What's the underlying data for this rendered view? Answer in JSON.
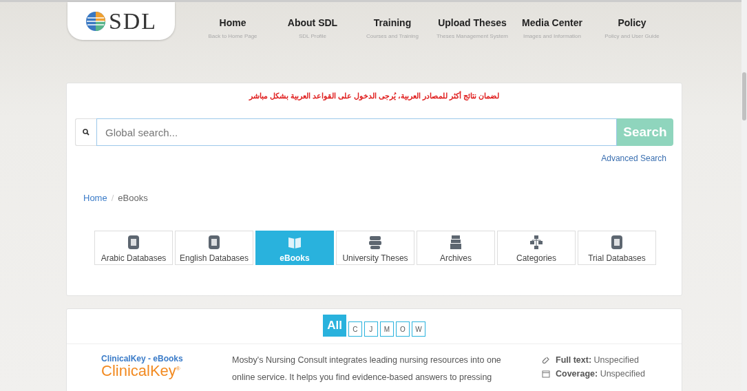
{
  "logo": {
    "text": "SDL"
  },
  "nav": [
    {
      "label": "Home",
      "subtitle": "Back to Home Page"
    },
    {
      "label": "About SDL",
      "subtitle": "SDL Profile"
    },
    {
      "label": "Training",
      "subtitle": "Courses and Training"
    },
    {
      "label": "Upload Theses",
      "subtitle": "Theses Management System"
    },
    {
      "label": "Media Center",
      "subtitle": "Images and Information"
    },
    {
      "label": "Policy",
      "subtitle": "Policy and User Guide"
    }
  ],
  "notice": "لضمان نتائج أكثر للمصادر العربية، يُرجى الدخول على القواعد العربية بشكل مباشر",
  "search": {
    "placeholder": "Global search...",
    "button": "Search",
    "advanced": "Advanced Search"
  },
  "breadcrumb": [
    "Home",
    "eBooks"
  ],
  "breadcrumb_separator": "/",
  "categories": [
    {
      "label": "Arabic Databases",
      "kind": "arabic",
      "selected": false
    },
    {
      "label": "English Databases",
      "kind": "english",
      "selected": false
    },
    {
      "label": "eBooks",
      "kind": "book",
      "selected": true
    },
    {
      "label": "University Theses",
      "kind": "theses",
      "selected": false
    },
    {
      "label": "Archives",
      "kind": "archives",
      "selected": false
    },
    {
      "label": "Categories",
      "kind": "categories",
      "selected": false
    },
    {
      "label": "Trial Databases",
      "kind": "trial",
      "selected": false
    }
  ],
  "letters": [
    {
      "label": "All",
      "selected": true
    },
    {
      "label": "C",
      "selected": false
    },
    {
      "label": "J",
      "selected": false
    },
    {
      "label": "M",
      "selected": false
    },
    {
      "label": "O",
      "selected": false
    },
    {
      "label": "W",
      "selected": false
    }
  ],
  "resource": {
    "title": "ClinicalKey - eBooks",
    "logo_text": "ClinicalKey$^{®}$",
    "description": "Mosby's Nursing Consult integrates leading nursing resources into one online service. It helps you find evidence-based answers to pressing",
    "meta": [
      {
        "kind": "link",
        "label": "Full text:",
        "value": "Unspecified"
      },
      {
        "kind": "calendar",
        "label": "Coverage:",
        "value": "Unspecified"
      }
    ]
  }
}
